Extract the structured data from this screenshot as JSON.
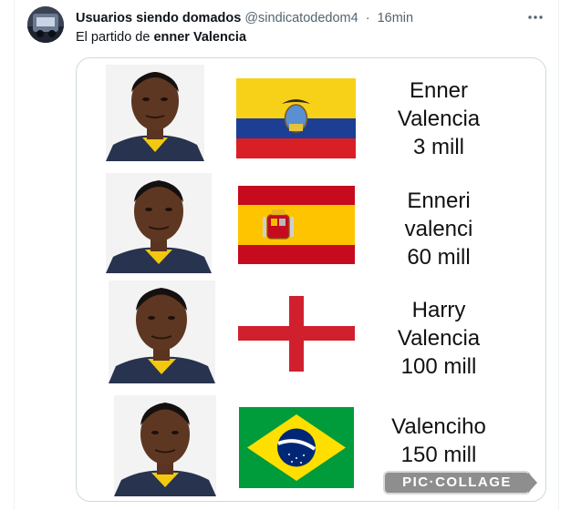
{
  "post": {
    "author_name": "Usuarios siendo domados",
    "handle": "@sindicatodedom4",
    "separator": "·",
    "time": "16min",
    "text_prefix": "El partido de ",
    "text_bold": "enner Valencia",
    "more_icon": "more-icon"
  },
  "meme": {
    "rows": [
      {
        "flag": "ecuador",
        "lines": [
          "Enner",
          "Valencia",
          "3 mill"
        ]
      },
      {
        "flag": "spain",
        "lines": [
          "Enneri",
          "valenci",
          "60 mill"
        ]
      },
      {
        "flag": "england",
        "lines": [
          "Harry",
          "Valencia",
          "100 mill"
        ]
      },
      {
        "flag": "brazil",
        "lines": [
          "Valenciho",
          "150 mill"
        ]
      }
    ],
    "watermark": "PIC·COLLAGE"
  },
  "colors": {
    "text_primary": "#0f1419",
    "text_secondary": "#536471",
    "border": "#cfd9de",
    "ecuador_yellow": "#f7d117",
    "ecuador_blue": "#1c3f94",
    "ecuador_red": "#d91f26",
    "spain_red": "#c60b1e",
    "spain_yellow": "#ffc400",
    "england_red": "#d0202e",
    "brazil_green": "#009b3a",
    "brazil_yellow": "#fedf00",
    "brazil_blue": "#002776"
  }
}
